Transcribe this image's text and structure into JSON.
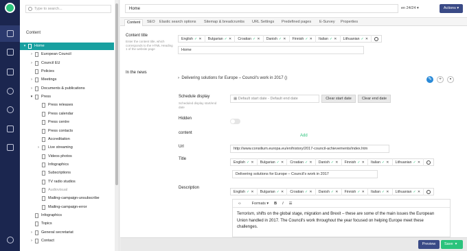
{
  "search": {
    "placeholder": "Type to search..."
  },
  "tree": {
    "title": "Content",
    "items": [
      {
        "label": "Home"
      },
      {
        "label": "European Council"
      },
      {
        "label": "Council EU"
      },
      {
        "label": "Policies"
      },
      {
        "label": "Meetings"
      },
      {
        "label": "Documents & publications"
      },
      {
        "label": "Press"
      },
      {
        "label": "Press releases"
      },
      {
        "label": "Press calendar"
      },
      {
        "label": "Press centre"
      },
      {
        "label": "Press contacts"
      },
      {
        "label": "Accreditation"
      },
      {
        "label": "Live streaming"
      },
      {
        "label": "Videos photos"
      },
      {
        "label": "Infographics"
      },
      {
        "label": "Subscriptions"
      },
      {
        "label": "TV radio studios"
      },
      {
        "label": "Audiovisual"
      },
      {
        "label": "Mailing-campaign-unsubscribe"
      },
      {
        "label": "Mailing-campaign-error"
      },
      {
        "label": "Infographics"
      },
      {
        "label": "Topics"
      },
      {
        "label": "General secretariat"
      },
      {
        "label": "Contact"
      }
    ]
  },
  "header": {
    "name_value": "Home",
    "pager": "en 24/24",
    "actions_label": "Actions"
  },
  "tabs": [
    "Content",
    "SEO",
    "Elastic search options",
    "Sitemap & breadcrumbs",
    "URL Settings",
    "Predefined pages",
    "E-Survey",
    "Properties"
  ],
  "content_title": {
    "label": "Content title",
    "description": "Enter the content title, which corresponds to the HTML Heading 1 of the website page",
    "languages": [
      "English",
      "Bulgarian",
      "Croatian",
      "Danish",
      "Finnish",
      "Italian",
      "Lithuanian"
    ],
    "value": "Home"
  },
  "in_the_news": {
    "label": "In the news",
    "item_title": "Delivering solutions for Europe – Council's work in 2017 ()"
  },
  "schedule": {
    "label": "Schedule display",
    "description": "Scheduled display start/end date",
    "placeholder": "Default start date - Default end date",
    "clear_start": "Clear start date",
    "clear_end": "Clear end date"
  },
  "hidden": {
    "label": "Hidden",
    "state": "off"
  },
  "content_field": {
    "label": "content",
    "add_label": "Add"
  },
  "url": {
    "label": "Url",
    "value": "http://www.consilium.europa.eu/en/history/2017-council-achievements/index.htm"
  },
  "title_field": {
    "label": "Title",
    "languages": [
      "English",
      "Bulgarian",
      "Croatian",
      "Danish",
      "Finnish",
      "Italian",
      "Lithuanian"
    ],
    "value": "Delivering solutions for Europe – Council's work in 2017"
  },
  "description_field": {
    "label": "Description",
    "languages": [
      "English",
      "Bulgarian",
      "Croatian",
      "Danish",
      "Finnish",
      "Italian",
      "Lithuanian"
    ],
    "toolbar": {
      "source": "‹›",
      "formats": "Formats",
      "bold": "B",
      "italic": "I",
      "list": "☰"
    },
    "text": "Terrorism, shifts on the global stage, migration and Brexit – these are some of the main issues the European Union handled in 2017. The Council's work throughout the year focused on helping Europe meet these challenges."
  },
  "footer": {
    "preview_label": "Preview",
    "save_label": "Save"
  },
  "colors": {
    "rail": "#1b264f",
    "selected": "#18a0a0",
    "accent": "#2bc37c",
    "primary": "#3a4a86"
  }
}
